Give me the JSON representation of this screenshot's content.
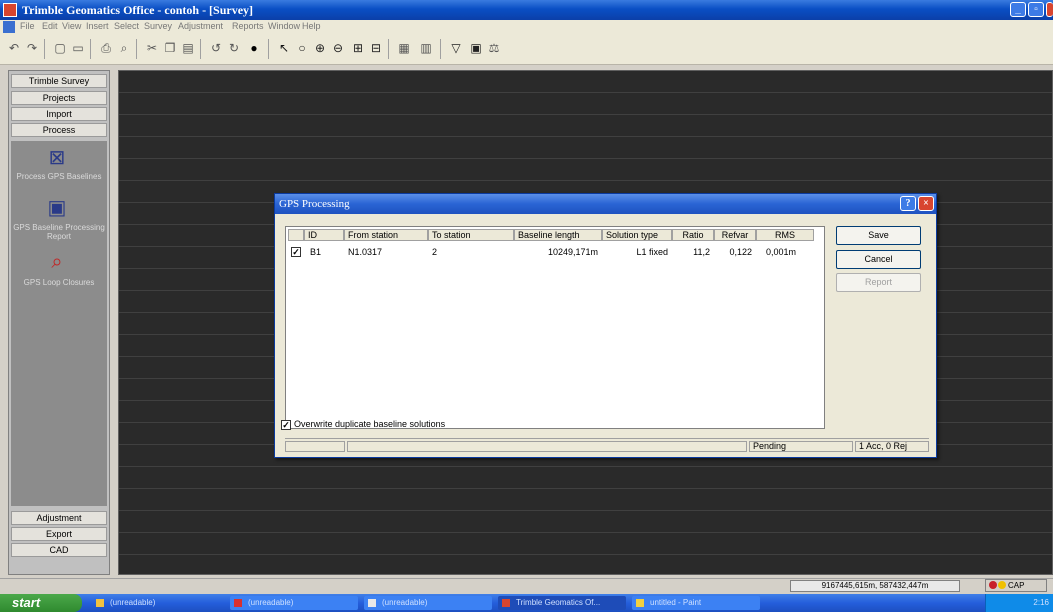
{
  "window": {
    "title": "Trimble Geomatics Office - contoh - [Survey]",
    "controls": {
      "minimize": "_",
      "maximize": "▫",
      "close": "×"
    }
  },
  "menu": [
    "File",
    "Edit",
    "View",
    "Insert",
    "Select",
    "Survey",
    "Adjustment",
    "Reports",
    "Window",
    "Help"
  ],
  "toolbar": {
    "icons": [
      "undo-icon",
      "redo-icon",
      "new-icon",
      "open-icon",
      "print-icon",
      "print-preview-icon",
      "cut-icon",
      "copy-icon",
      "paste-icon",
      "undo2-icon",
      "redo2-icon",
      "info-icon",
      "select-icon",
      "pan-icon",
      "zoom-in-icon",
      "zoom-out-icon",
      "zoom-window-icon",
      "zoom-extents-icon",
      "grid-icon",
      "table-icon",
      "filter-icon",
      "properties-icon",
      "scale-icon"
    ]
  },
  "sidebar": {
    "header": "Trimble Survey",
    "top_items": [
      "Projects",
      "Import",
      "Process"
    ],
    "panel_items": [
      {
        "icon": "process-gps-icon",
        "label": "Process GPS Baselines"
      },
      {
        "icon": "report-icon",
        "label": "GPS Baseline Processing Report"
      },
      {
        "icon": "loop-closure-icon",
        "label": "GPS Loop Closures"
      }
    ],
    "bottom_items": [
      "Adjustment",
      "Export",
      "CAD"
    ]
  },
  "dialog": {
    "title": "GPS Processing",
    "help": "?",
    "close": "×",
    "columns": [
      "ID",
      "From station",
      "To station",
      "Baseline length",
      "Solution type",
      "Ratio",
      "Refvar",
      "RMS"
    ],
    "rows": [
      {
        "checked": "✓",
        "id": "B1",
        "from": "N1.0317",
        "to": "2",
        "length": "10249,171m",
        "solution": "L1 fixed",
        "ratio": "11,2",
        "refvar": "0,122",
        "rms": "0,001m"
      }
    ],
    "buttons": {
      "save": "Save",
      "cancel": "Cancel",
      "report": "Report"
    },
    "overwrite": {
      "checked": "✓",
      "label": "Overwrite duplicate baseline solutions"
    },
    "status": {
      "state": "Pending",
      "summary": "1 Acc, 0 Rej"
    }
  },
  "statusbar": {
    "coords": "9167445,615m, 587432,447m",
    "indicator": "CAP"
  },
  "taskbar": {
    "start": "start",
    "tasks": [
      "(unreadable)",
      "(unreadable)",
      "(unreadable)",
      "Trimble Geomatics Of...",
      "untitled - Paint"
    ],
    "clock": "2:16"
  },
  "colors": {
    "titlebar": "#0a4fc4",
    "workspace": "#2a2a2a",
    "sidebar_panel": "#8c8c8c",
    "dialog_bg": "#ece9d8",
    "taskbar": "#245edb",
    "start_green": "#2f8a2f"
  }
}
